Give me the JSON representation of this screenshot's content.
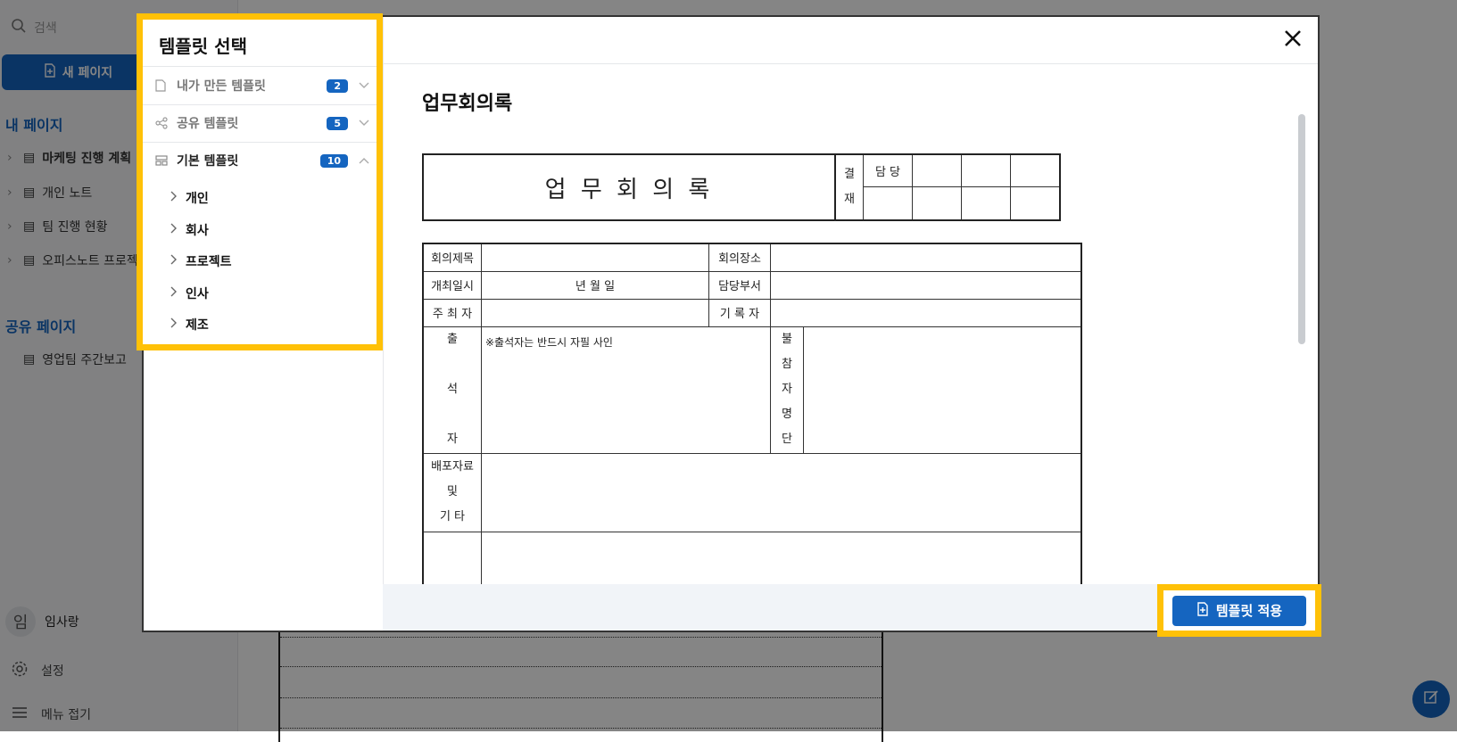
{
  "sidebar": {
    "search_placeholder": "검색",
    "new_page_label": "새 페이지",
    "my_pages_title": "내 페이지",
    "my_pages": [
      {
        "label": "마케팅 진행 계획",
        "bold": true
      },
      {
        "label": "개인 노트"
      },
      {
        "label": "팀 진행 현황"
      },
      {
        "label": "오피스노트 프로젝트"
      }
    ],
    "shared_pages_title": "공유 페이지",
    "shared_pages": [
      {
        "label": "영업팀 주간보고"
      }
    ],
    "user": {
      "avatar_char": "임",
      "name": "임사랑"
    },
    "settings_label": "설정",
    "collapse_label": "메뉴 접기"
  },
  "modal": {
    "title": "템플릿 선택",
    "categories": [
      {
        "label": "내가 만든 템플릿",
        "count": "2",
        "icon": "document-icon",
        "expanded": false
      },
      {
        "label": "공유 템플릿",
        "count": "5",
        "icon": "share-icon",
        "expanded": false
      },
      {
        "label": "기본 템플릿",
        "count": "10",
        "icon": "layout-icon",
        "expanded": true
      }
    ],
    "subcategories": [
      "개인",
      "회사",
      "프로젝트",
      "인사",
      "제조"
    ],
    "preview_title": "업무회의록",
    "apply_label": "템플릿 적용"
  },
  "document": {
    "heading": "업 무 회 의 록",
    "approval_label": [
      "결",
      "재"
    ],
    "approval_role": "담 당",
    "meeting_title": "회의제목",
    "meeting_place": "회의장소",
    "meeting_datetime": "개최일시",
    "date_template": "년  월  일",
    "department": "담당부서",
    "host": "주 최 자",
    "recorder": "기 록 자",
    "attendees": [
      "출",
      "석",
      "자"
    ],
    "attendee_note": "※출석자는 반드시 자필 사인",
    "absentees": [
      "불",
      "참",
      "자",
      "명",
      "단"
    ],
    "handouts": [
      "배포자료",
      "및",
      "기 타"
    ]
  },
  "colors": {
    "accent": "#1565c0",
    "highlight": "#ffc107"
  }
}
